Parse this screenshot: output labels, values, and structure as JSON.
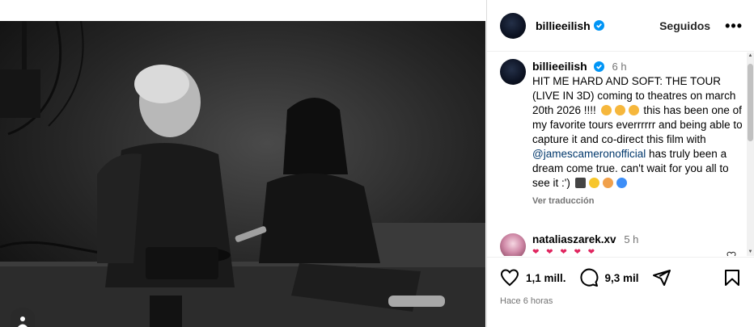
{
  "post": {
    "username": "billieeilish",
    "follow_label": "Seguidos",
    "more_label": "•••",
    "caption_time": "6 h",
    "caption_text": "HIT ME HARD AND SOFT: THE TOUR (LIVE IN 3D) coming to theatres on march 20th 2026 !!!! ",
    "caption_text2": " this has been one of my favorite tours everrrrrr and being able to capture it and co-direct this film with ",
    "mention": "@jamescameronofficial",
    "caption_text3": " has truly been a dream come true. can't wait for you all to see it :') ",
    "translate_label": "Ver traducción"
  },
  "comment": {
    "username": "nataliaszarek.xv",
    "time": "5 h",
    "text": "❤ ❤ ❤ ❤ ❤"
  },
  "actions": {
    "likes": "1,1 mill.",
    "comments": "9,3 mil",
    "posted_ago": "Hace 6 horas"
  },
  "colors": {
    "verified": "#0095f6",
    "mention": "#00376b",
    "secondary": "#737373"
  }
}
